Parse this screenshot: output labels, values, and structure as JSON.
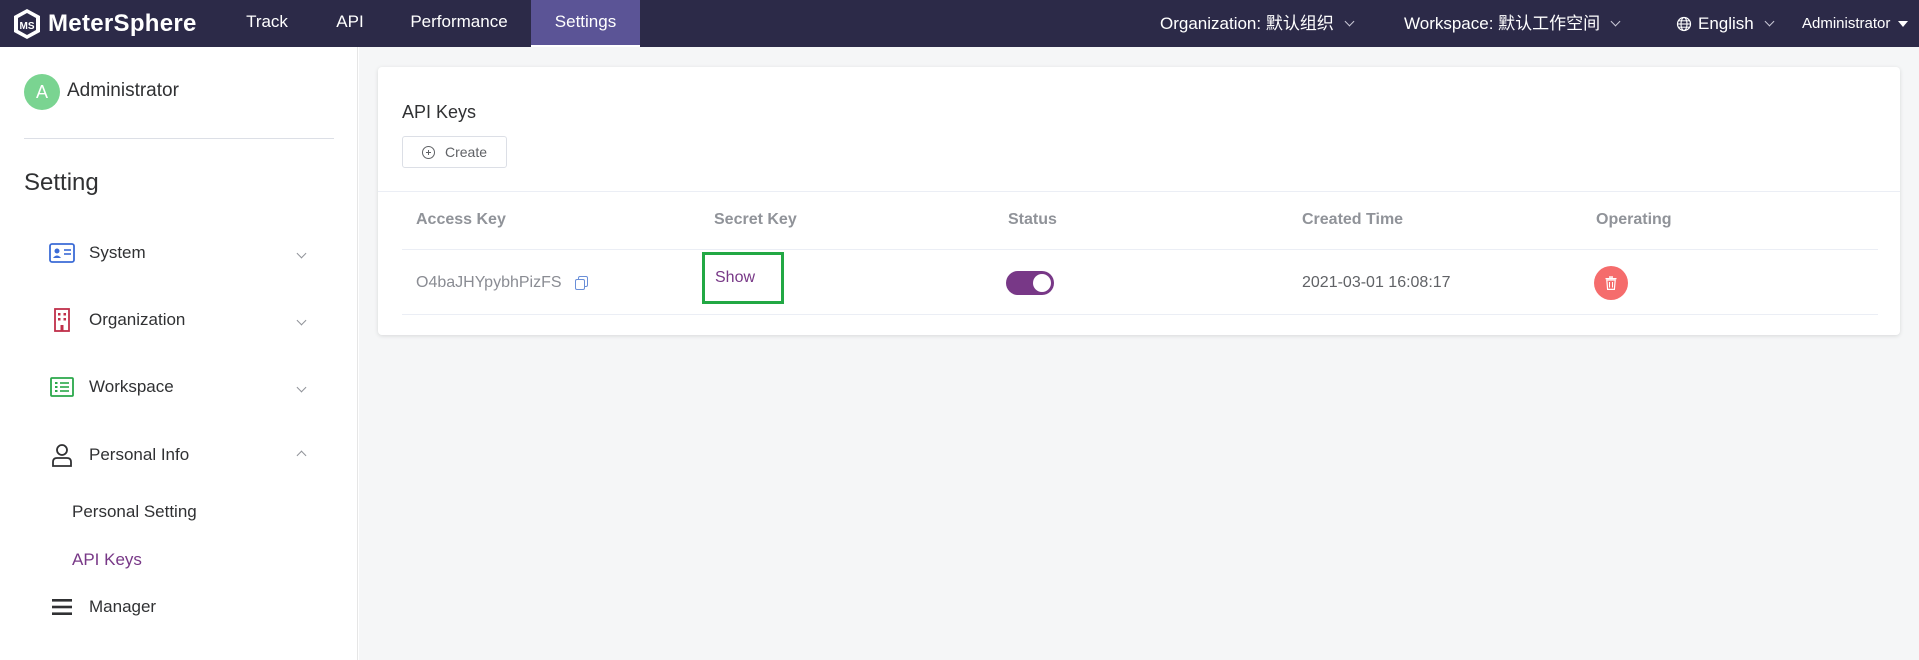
{
  "topbar": {
    "logo_text": "MeterSphere",
    "nav": [
      {
        "label": "Track"
      },
      {
        "label": "API"
      },
      {
        "label": "Performance"
      },
      {
        "label": "Settings"
      }
    ],
    "organization": "Organization: 默认组织",
    "workspace": "Workspace: 默认工作空间",
    "language": "English",
    "user": "Administrator"
  },
  "sidebar": {
    "avatar_letter": "A",
    "user_name": "Administrator",
    "title": "Setting",
    "menus": [
      {
        "label": "System",
        "icon": "id-card-icon"
      },
      {
        "label": "Organization",
        "icon": "building-icon"
      },
      {
        "label": "Workspace",
        "icon": "list-icon"
      },
      {
        "label": "Personal Info",
        "icon": "user-icon"
      }
    ],
    "sub_items": [
      {
        "label": "Personal Setting"
      },
      {
        "label": "API Keys"
      }
    ],
    "manager": {
      "label": "Manager",
      "icon": "menu-icon"
    }
  },
  "main": {
    "title": "API Keys",
    "create_label": "Create",
    "columns": [
      "Access Key",
      "Secret Key",
      "Status",
      "Created Time",
      "Operating"
    ],
    "rows": [
      {
        "access_key": "O4baJHYpybhPizFS",
        "secret_key_label": "Show",
        "status_enabled": true,
        "created_time": "2021-03-01 16:08:17"
      }
    ]
  },
  "colors": {
    "topbar": "#2c2a48",
    "active_tab": "#5b5496",
    "accent": "#783887",
    "danger": "#f56c6c",
    "highlight_box": "#22a844"
  }
}
